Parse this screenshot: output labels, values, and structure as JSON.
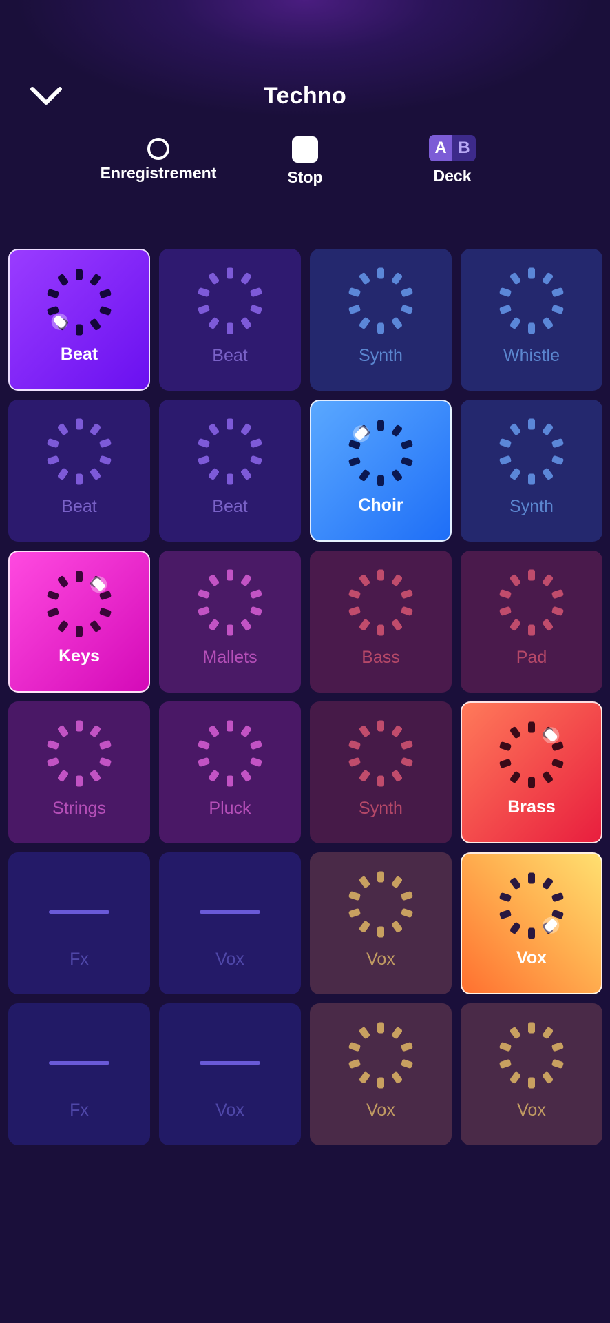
{
  "header": {
    "title": "Techno",
    "controls": [
      {
        "label": "Enregistrement",
        "icon": "record-icon"
      },
      {
        "label": "Stop",
        "icon": "stop-icon"
      },
      {
        "label": "Deck",
        "icon": "deck-ab-icon",
        "deck_a": "A",
        "deck_b": "B"
      }
    ]
  },
  "colors": {
    "background": "#1a0f3a",
    "beat_active": "#8a2cff",
    "choir_active": "#2f8cff",
    "keys_active": "#ff36d8",
    "brass_active": "#f03a48",
    "vox_active": "#ffb347"
  },
  "pads": [
    {
      "label": "Beat",
      "state": "active"
    },
    {
      "label": "Beat",
      "state": "idle"
    },
    {
      "label": "Synth",
      "state": "idle"
    },
    {
      "label": "Whistle",
      "state": "idle"
    },
    {
      "label": "Beat",
      "state": "idle"
    },
    {
      "label": "Beat",
      "state": "idle"
    },
    {
      "label": "Choir",
      "state": "active"
    },
    {
      "label": "Synth",
      "state": "idle"
    },
    {
      "label": "Keys",
      "state": "active"
    },
    {
      "label": "Mallets",
      "state": "idle"
    },
    {
      "label": "Bass",
      "state": "idle"
    },
    {
      "label": "Pad",
      "state": "idle"
    },
    {
      "label": "Strings",
      "state": "idle"
    },
    {
      "label": "Pluck",
      "state": "idle"
    },
    {
      "label": "Synth",
      "state": "idle"
    },
    {
      "label": "Brass",
      "state": "active"
    },
    {
      "label": "Fx",
      "state": "empty"
    },
    {
      "label": "Vox",
      "state": "empty"
    },
    {
      "label": "Vox",
      "state": "idle"
    },
    {
      "label": "Vox",
      "state": "active"
    },
    {
      "label": "Fx",
      "state": "empty"
    },
    {
      "label": "Vox",
      "state": "empty"
    },
    {
      "label": "Vox",
      "state": "idle"
    },
    {
      "label": "Vox",
      "state": "idle"
    }
  ]
}
